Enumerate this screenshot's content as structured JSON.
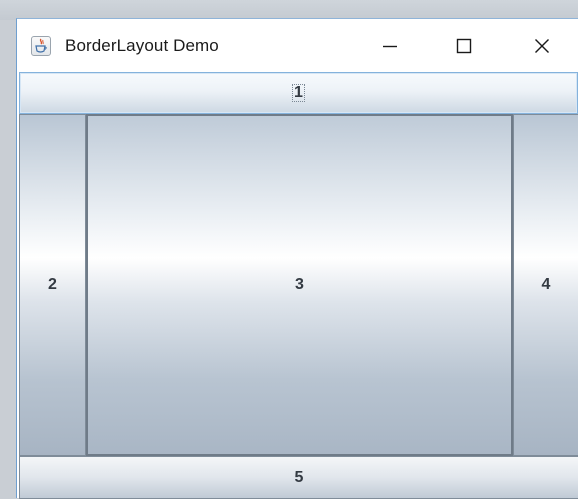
{
  "window": {
    "title": "BorderLayout Demo",
    "icon": "java-cup-icon",
    "controls": [
      "minimize-icon",
      "maximize-icon",
      "close-icon"
    ]
  },
  "buttons": {
    "north": "1",
    "west": "2",
    "center": "3",
    "east": "4",
    "south": "5"
  }
}
